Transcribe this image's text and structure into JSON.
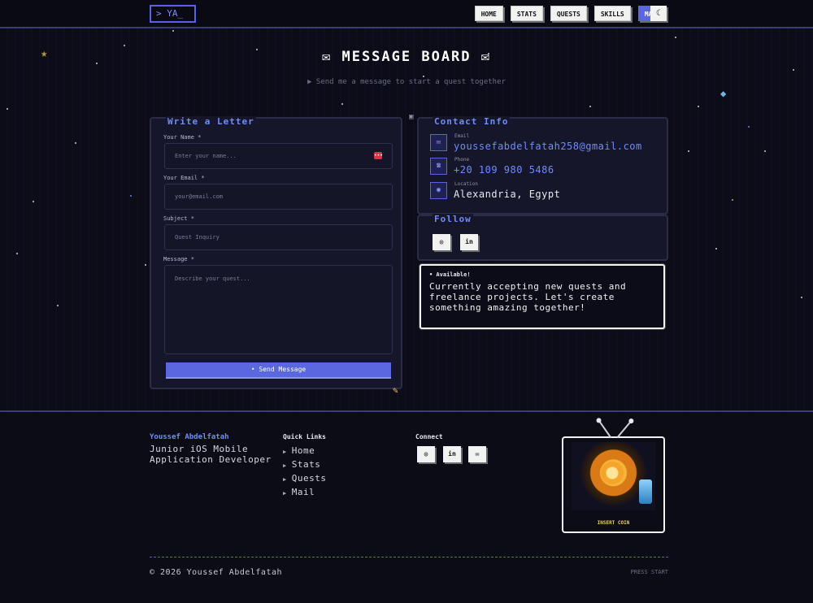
{
  "nav": {
    "logo": "> YA_",
    "links": [
      "HOME",
      "STATS",
      "QUESTS",
      "SKILLS",
      "MAIL"
    ],
    "active": "MAIL",
    "theme_icon": "☾"
  },
  "header": {
    "title": "✉ MESSAGE BOARD ✉",
    "subtitle": "▶ Send me a message to start a quest together"
  },
  "form": {
    "title": "Write a Letter",
    "name_label": "Your Name *",
    "name_placeholder": "Enter your name...",
    "email_label": "Your Email *",
    "email_placeholder": "your@email.com",
    "subject_label": "Subject *",
    "subject_placeholder": "Quest Inquiry",
    "message_label": "Message *",
    "message_placeholder": "Describe your quest...",
    "send_label": "• Send Message",
    "key_icon": "•••"
  },
  "contact": {
    "title": "Contact Info",
    "items": [
      {
        "label": "Email",
        "value": "youssefabdelfatah258@gmail.com",
        "icon": "✉"
      },
      {
        "label": "Phone",
        "value": "+20 109 980 5486",
        "icon": "☎"
      },
      {
        "label": "Location",
        "value": "Alexandria, Egypt",
        "icon": "◉"
      }
    ]
  },
  "follow": {
    "title": "Follow",
    "icons": [
      "◎",
      "in"
    ]
  },
  "availability": {
    "title": "• Available!",
    "text": "Currently accepting new quests and freelance projects. Let's create something amazing together!"
  },
  "footer": {
    "name": "Youssef Abdelfatah",
    "role": "Junior iOS Mobile Application Developer",
    "quick_links_title": "Quick Links",
    "quick_links": [
      "Home",
      "Stats",
      "Quests",
      "Mail"
    ],
    "connect_title": "Connect",
    "connect_icons": [
      "◎",
      "in",
      "✉"
    ],
    "copyright": "© 2026 Youssef Abdelfatah",
    "press_start": "PRESS START",
    "insert_coin": "INSERT COIN"
  },
  "colors": {
    "accent": "#5a67e0",
    "title_blue": "#6f8cff",
    "background": "#0c0c18"
  }
}
